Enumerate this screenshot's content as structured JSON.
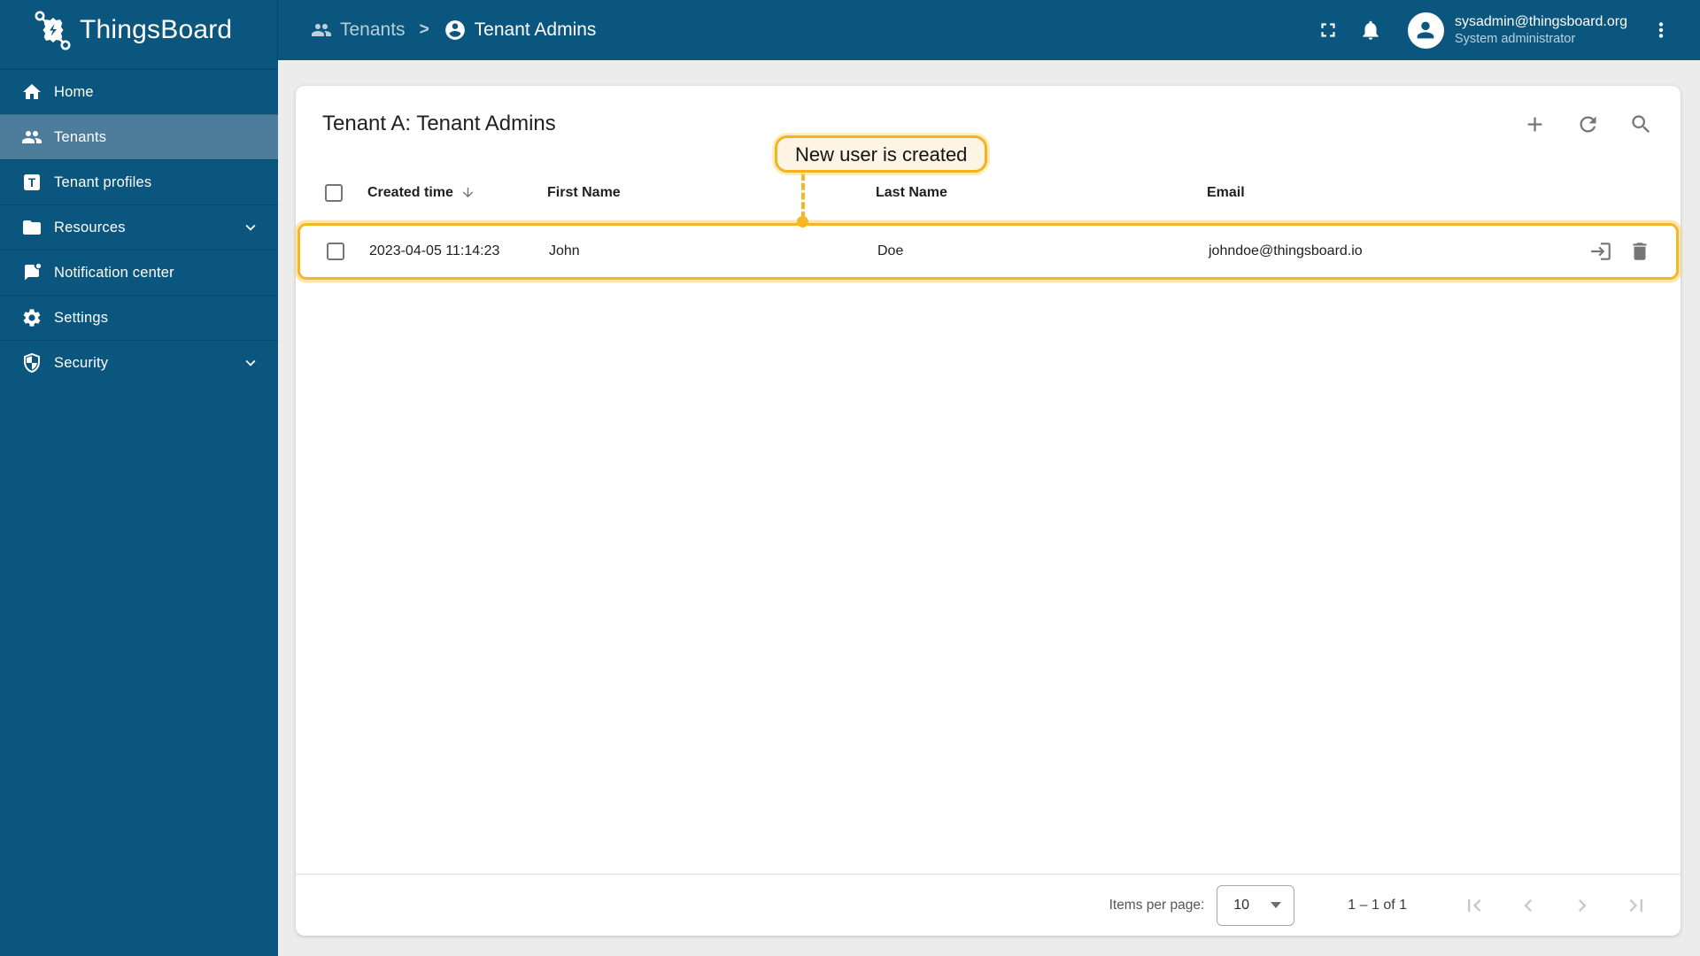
{
  "header": {
    "logo_text": "ThingsBoard",
    "breadcrumb": {
      "separator": ">",
      "items": [
        {
          "label": "Tenants",
          "icon": "tenants-icon"
        },
        {
          "label": "Tenant Admins",
          "icon": "account-circle-icon"
        }
      ]
    },
    "user": {
      "email": "sysadmin@thingsboard.org",
      "role": "System administrator"
    }
  },
  "sidebar": {
    "items": [
      {
        "label": "Home",
        "icon": "home-icon",
        "selected": false
      },
      {
        "label": "Tenants",
        "icon": "tenants-icon",
        "selected": true
      },
      {
        "label": "Tenant profiles",
        "icon": "tenant-profile-icon",
        "selected": false
      },
      {
        "label": "Resources",
        "icon": "folder-icon",
        "selected": false,
        "expandable": true
      },
      {
        "label": "Notification center",
        "icon": "notification-icon",
        "selected": false
      },
      {
        "label": "Settings",
        "icon": "gear-icon",
        "selected": false
      },
      {
        "label": "Security",
        "icon": "shield-icon",
        "selected": false,
        "expandable": true
      }
    ]
  },
  "main": {
    "title": "Tenant A: Tenant Admins",
    "toolbar_icons": [
      "add-icon",
      "refresh-icon",
      "search-icon"
    ],
    "table": {
      "columns": {
        "time": "Created time",
        "first": "First Name",
        "last": "Last Name",
        "email": "Email"
      },
      "sort": {
        "column": "Created time",
        "direction": "desc"
      },
      "rows": [
        {
          "created_time": "2023-04-05 11:14:23",
          "first_name": "John",
          "last_name": "Doe",
          "email": "johndoe@thingsboard.io",
          "row_actions": [
            "login-as-user-icon",
            "delete-icon"
          ]
        }
      ]
    },
    "annotation": {
      "text": "New user is created"
    },
    "pagination": {
      "items_per_page_label": "Items per page:",
      "items_per_page_value": "10",
      "range_text": "1 – 1 of 1",
      "controls": [
        "first-page-icon",
        "prev-page-icon",
        "next-page-icon",
        "last-page-icon"
      ]
    }
  },
  "colors": {
    "primary": "#0a567e",
    "sidebar_selected": "#4e7c9b",
    "content_bg": "#ececec",
    "card_bg": "#ffffff",
    "highlight_yellow": "#f4b826",
    "tooltip_bg": "#fdf4e3",
    "icon_gray": "#757575",
    "disabled_gray": "#c8c8c8",
    "text_dark": "#212121",
    "breadcrumb_muted": "#b9cfdc"
  }
}
